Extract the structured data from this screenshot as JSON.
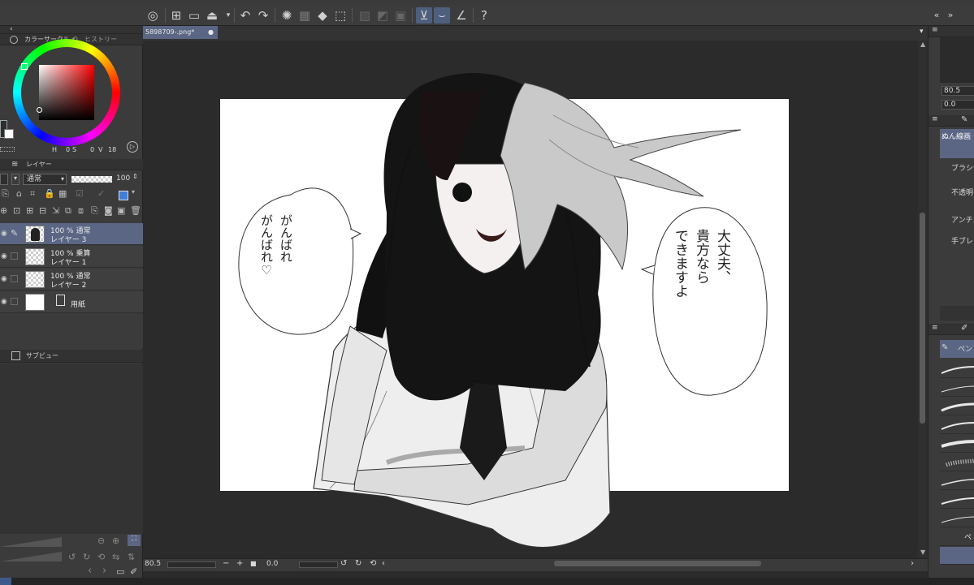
{
  "document": {
    "tab_title": "5898709-.png*"
  },
  "left_panel": {
    "color_tabs": [
      "カラーサークル",
      "ヒストリー"
    ],
    "color_values": {
      "h_label": "H",
      "h_value": "0",
      "s_label": "S",
      "s_value": "0",
      "v_label": "V",
      "v_value": "18"
    },
    "layer_tab": "レイヤー",
    "blend_mode": "通常",
    "opacity": "100",
    "layers": [
      {
        "line1": "100 % 通常",
        "line2": "レイヤー 3",
        "selected": true
      },
      {
        "line1": "100 % 乗算",
        "line2": "レイヤー 1",
        "selected": false
      },
      {
        "line1": "100 % 通常",
        "line2": "レイヤー 2",
        "selected": false
      },
      {
        "line1": "",
        "line2": "用紙",
        "selected": false
      }
    ],
    "subview_tab": "サブビュー"
  },
  "status_bar": {
    "zoom": "80.5",
    "rotation": "0.0"
  },
  "right_panel": {
    "zoom": "80.5",
    "rotation": "0.0",
    "tool_label": "ぬん線画",
    "props": [
      "ブラシサ",
      "不透明",
      "アンチエ",
      "手ブレ"
    ],
    "brush_tab": "ペン",
    "brush_last": "ペ"
  },
  "artwork": {
    "left_bubble_lines": [
      "がんばれ",
      "がんばれ♡"
    ],
    "right_bubble_lines": [
      "大丈夫、",
      "貴方なら",
      "できますよ"
    ]
  },
  "colors": {
    "accent": "#5a6684",
    "panel": "#3b3b3b",
    "canvas_bg": "#2b2b2b"
  }
}
